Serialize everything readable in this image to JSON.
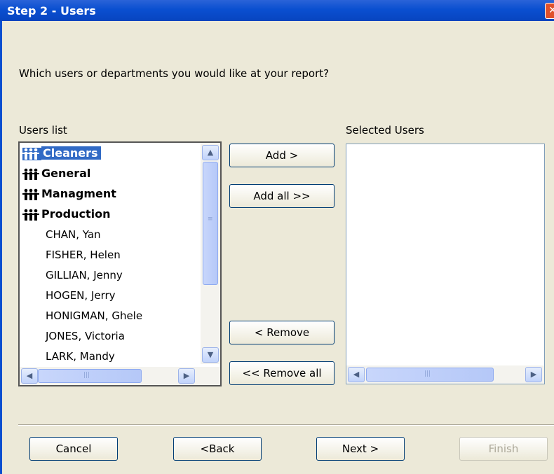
{
  "window": {
    "title": "Step 2 - Users",
    "close_glyph": "✕"
  },
  "question": "Which users or departments you would like at your report?",
  "users_list": {
    "label": "Users list",
    "groups": [
      {
        "label": "Cleaners",
        "selected": true
      },
      {
        "label": "General",
        "selected": false
      },
      {
        "label": "Managment",
        "selected": false
      },
      {
        "label": "Production",
        "selected": false
      }
    ],
    "users": [
      "CHAN, Yan",
      "FISHER, Helen",
      "GILLIAN, Jenny",
      "HOGEN, Jerry",
      "HONIGMAN, Ghele",
      "JONES, Victoria",
      "LARK, Mandy"
    ]
  },
  "selected_users": {
    "label": "Selected Users",
    "items": []
  },
  "buttons": {
    "add": "Add >",
    "add_all": "Add all >>",
    "remove": "< Remove",
    "remove_all": "<< Remove all"
  },
  "footer": {
    "cancel": "Cancel",
    "back": "<Back",
    "next": "Next >",
    "finish": "Finish",
    "finish_enabled": false
  },
  "icons": {
    "group": "group-people-icon",
    "scroll_up": "▲",
    "scroll_down": "▼",
    "scroll_left": "◀",
    "scroll_right": "▶",
    "grip_v": "≡",
    "grip_h": "|||"
  },
  "colors": {
    "titlebar": "#0a4fd0",
    "selection": "#316ac5",
    "dialog_bg": "#ece9d8"
  }
}
